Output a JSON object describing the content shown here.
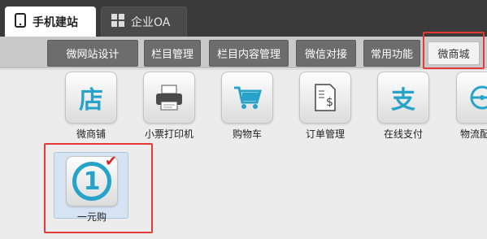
{
  "top_tabs": [
    {
      "label": "手机建站",
      "icon": "phone-icon",
      "active": true
    },
    {
      "label": "企业OA",
      "icon": "grid-icon",
      "active": false
    }
  ],
  "sub_tabs": [
    {
      "label": "微网站设计"
    },
    {
      "label": "栏目管理"
    },
    {
      "label": "栏目内容管理"
    },
    {
      "label": "微信对接"
    },
    {
      "label": "常用功能"
    },
    {
      "label": "微商城",
      "selected": true
    }
  ],
  "tools": [
    {
      "label": "微商铺",
      "icon": "shop-icon",
      "glyph": "店"
    },
    {
      "label": "小票打印机",
      "icon": "printer-icon",
      "glyph": "🖶"
    },
    {
      "label": "购物车",
      "icon": "cart-icon",
      "glyph": "🛒"
    },
    {
      "label": "订单管理",
      "icon": "order-icon",
      "glyph": "$"
    },
    {
      "label": "在线支付",
      "icon": "payment-icon",
      "glyph": "支"
    },
    {
      "label": "物流配",
      "icon": "logistics-icon",
      "glyph": "◎"
    }
  ],
  "featured": {
    "label": "一元购",
    "icon": "one-yuan-icon",
    "glyph": "1",
    "check": "✔"
  },
  "colors": {
    "accent": "#27a3c9",
    "highlight": "#e53935",
    "dark_bar": "#3a3a3a",
    "tab_gray": "#6d6d6d"
  }
}
